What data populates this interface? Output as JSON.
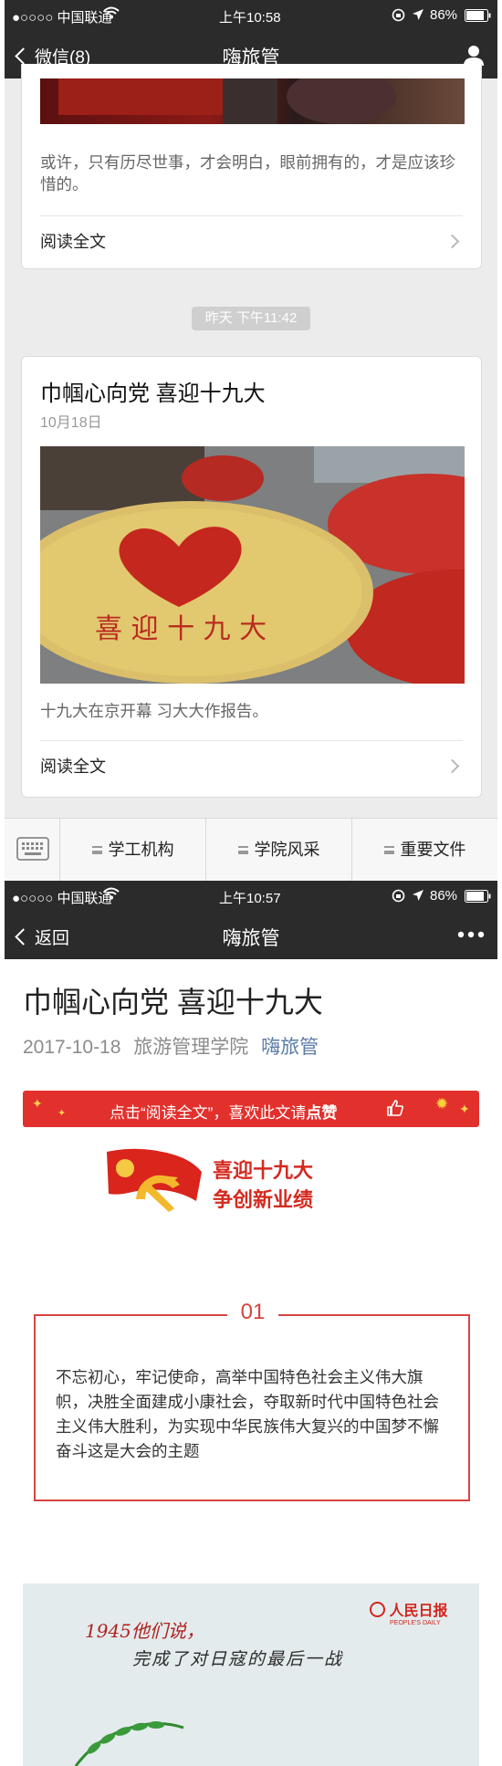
{
  "screen1": {
    "status": {
      "carrier": "●○○○○ 中国联通",
      "time": "上午10:58",
      "battery": "86%"
    },
    "nav": {
      "back_label": "微信(8)",
      "title": "嗨旅管"
    },
    "card_prev": {
      "excerpt": "或许，只有历尽世事，才会明白，眼前拥有的，才是应该珍惜的。",
      "readmore": "阅读全文"
    },
    "timestamp": "昨天 下午11:42",
    "card": {
      "title": "巾帼心向党 喜迎十九大",
      "date": "10月18日",
      "excerpt": "十九大在京开幕 习大大作报告。",
      "readmore": "阅读全文"
    },
    "tabs": [
      {
        "label": "学工机构"
      },
      {
        "label": "学院风采"
      },
      {
        "label": "重要文件"
      }
    ]
  },
  "screen2": {
    "status": {
      "carrier": "●○○○○ 中国联通",
      "time": "上午10:57",
      "battery": "86%"
    },
    "nav": {
      "back_label": "返回",
      "title": "嗨旅管"
    },
    "article": {
      "title": "巾帼心向党 喜迎十九大",
      "date": "2017-10-18",
      "author": "旅游管理学院",
      "account": "嗨旅管",
      "banner_text": "点击“阅读全文”，喜欢此文请",
      "banner_bold": "点赞",
      "slogan_1": "喜迎十九大",
      "slogan_2": "争创新业绩",
      "section_num": "01",
      "section_text": "不忘初心，牢记使命，高举中国特色社会主义伟大旗帜，决胜全面建成小康社会，夺取新时代中国特色社会主义伟大胜利，为实现中华民族伟大复兴的中国梦不懈奋斗这是大会的主题",
      "poster_line1": "1945他们说，",
      "poster_line2": "完成了对日寇的最后一战",
      "poster_logo": "人民日报",
      "poster_logo_en": "PEOPLE'S DAILY"
    }
  }
}
